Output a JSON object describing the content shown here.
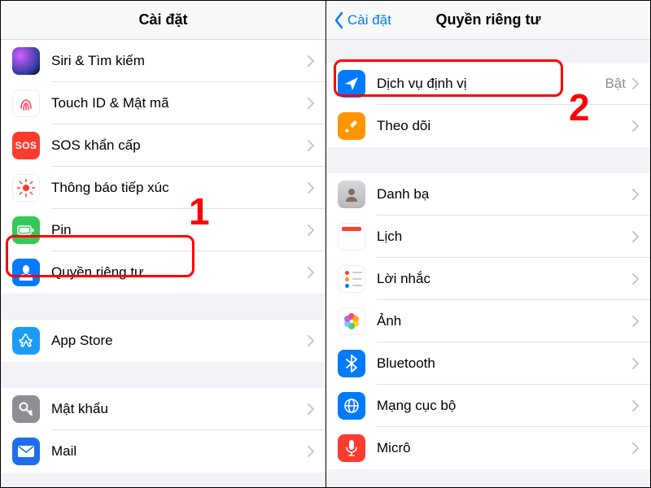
{
  "left": {
    "title": "Cài đặt",
    "stepNumber": "1",
    "items": [
      {
        "label": "Siri & Tìm kiếm"
      },
      {
        "label": "Touch ID & Mật mã"
      },
      {
        "label": "SOS khẩn cấp",
        "sos": "SOS"
      },
      {
        "label": "Thông báo tiếp xúc"
      },
      {
        "label": "Pin"
      },
      {
        "label": "Quyền riêng tư"
      }
    ],
    "appstore": {
      "label": "App Store"
    },
    "passwords": {
      "label": "Mật khẩu"
    },
    "mail": {
      "label": "Mail"
    }
  },
  "right": {
    "backLabel": "Cài đặt",
    "title": "Quyền riêng tư",
    "stepNumber": "2",
    "location": {
      "label": "Dịch vụ định vị",
      "value": "Bật"
    },
    "tracking": {
      "label": "Theo dõi"
    },
    "items": [
      {
        "label": "Danh bạ"
      },
      {
        "label": "Lịch"
      },
      {
        "label": "Lời nhắc"
      },
      {
        "label": "Ảnh"
      },
      {
        "label": "Bluetooth"
      },
      {
        "label": "Mạng cục bộ"
      },
      {
        "label": "Micrô"
      }
    ]
  }
}
